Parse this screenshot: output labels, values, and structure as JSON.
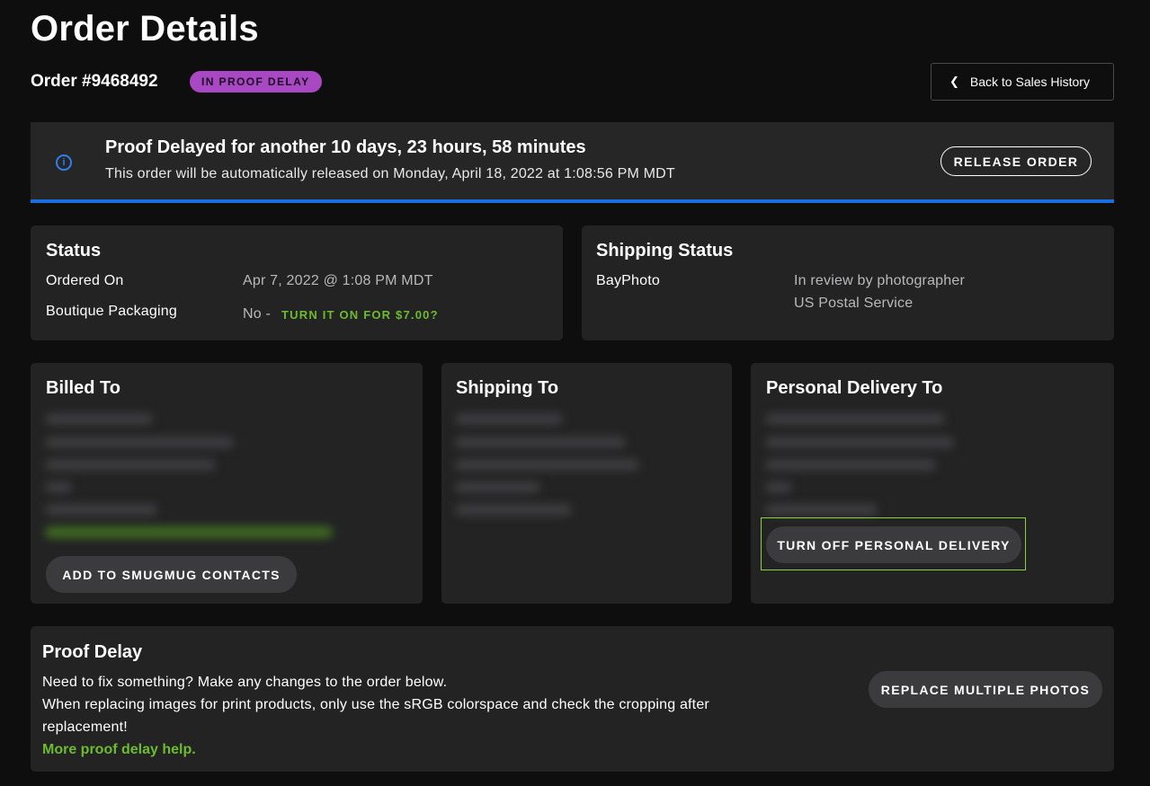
{
  "header": {
    "title": "Order Details",
    "order_number": "Order #9468492",
    "status_badge": "IN PROOF DELAY",
    "back_label": "Back to Sales History"
  },
  "banner": {
    "title": "Proof Delayed for another 10 days, 23 hours, 58 minutes",
    "subtitle": "This order will be automatically released on Monday, April 18, 2022 at 1:08:56 PM MDT",
    "release_label": "RELEASE ORDER",
    "icon": "info-icon"
  },
  "status_card": {
    "title": "Status",
    "ordered_on_label": "Ordered On",
    "ordered_on_value": "Apr 7, 2022 @ 1:08 PM MDT",
    "packaging_label": "Boutique Packaging",
    "packaging_value": "No -",
    "packaging_link": "TURN IT ON FOR $7.00?"
  },
  "shipping_status_card": {
    "title": "Shipping Status",
    "lab": "BayPhoto",
    "status": "In review by photographer",
    "carrier": "US Postal Service"
  },
  "billed_to": {
    "title": "Billed To",
    "add_contact_label": "ADD TO SMUGMUG CONTACTS"
  },
  "shipping_to": {
    "title": "Shipping To"
  },
  "personal_delivery": {
    "title": "Personal Delivery To",
    "turn_off_label": "TURN OFF PERSONAL DELIVERY"
  },
  "proof_delay": {
    "title": "Proof Delay",
    "line1": "Need to fix something? Make any changes to the order below.",
    "line2": "When replacing images for print products, only use the sRGB colorspace and check the cropping after",
    "line3": "replacement!",
    "help_link": "More proof delay help.",
    "replace_label": "REPLACE MULTIPLE PHOTOS"
  },
  "colors": {
    "background": "#0e0e0f",
    "card": "#232324",
    "accent_blue": "#1a6fe0",
    "status_purple": "#a848c2",
    "link_green": "#6dbb2e"
  }
}
